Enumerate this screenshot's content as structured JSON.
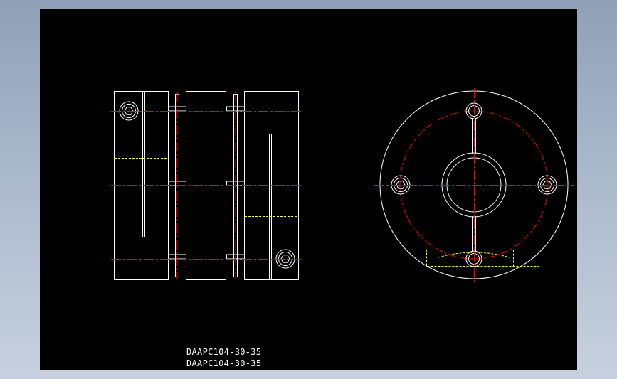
{
  "drawing": {
    "part_number": "DAAPC104-30-35",
    "part_number_repeat": "DAAPC104-30-35"
  },
  "colors": {
    "outline": "#ffffff",
    "centerline": "#ff0000",
    "hidden": "#ffff00",
    "background": "#000000"
  }
}
